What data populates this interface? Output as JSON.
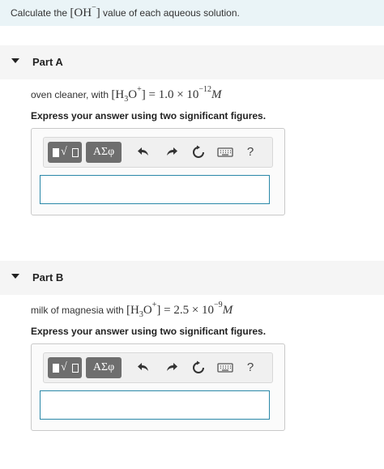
{
  "header": {
    "prefix": "Calculate the ",
    "oh": "OH",
    "minus": "−",
    "suffix": " value of each aqueous solution."
  },
  "partA": {
    "title": "Part A",
    "prompt_text": "oven cleaner, with ",
    "h3o_h": "H",
    "h3o_sub": "3",
    "h3o_o": "O",
    "h3o_plus": "+",
    "equals": " = 1.0 × 10",
    "exponent": "−12",
    "unit": "M",
    "instruction": "Express your answer using two significant figures."
  },
  "partB": {
    "title": "Part B",
    "prompt_text": "milk of magnesia with ",
    "h3o_h": "H",
    "h3o_sub": "3",
    "h3o_o": "O",
    "h3o_plus": "+",
    "equals": " = 2.5 × 10",
    "exponent": "−9",
    "unit": "M",
    "instruction": "Express your answer using two significant figures."
  },
  "toolbar": {
    "greek_label": "ΑΣφ",
    "help_label": "?",
    "icons": [
      "templates-icon",
      "greek-symbols-icon",
      "undo-icon",
      "redo-icon",
      "reset-icon",
      "keyboard-icon",
      "help-icon"
    ]
  },
  "colors": {
    "header_bg": "#eaf4f7",
    "part_bg": "#f5f5f5",
    "toolbar_button": "#6e6e6e",
    "input_border": "#2a88a8"
  }
}
